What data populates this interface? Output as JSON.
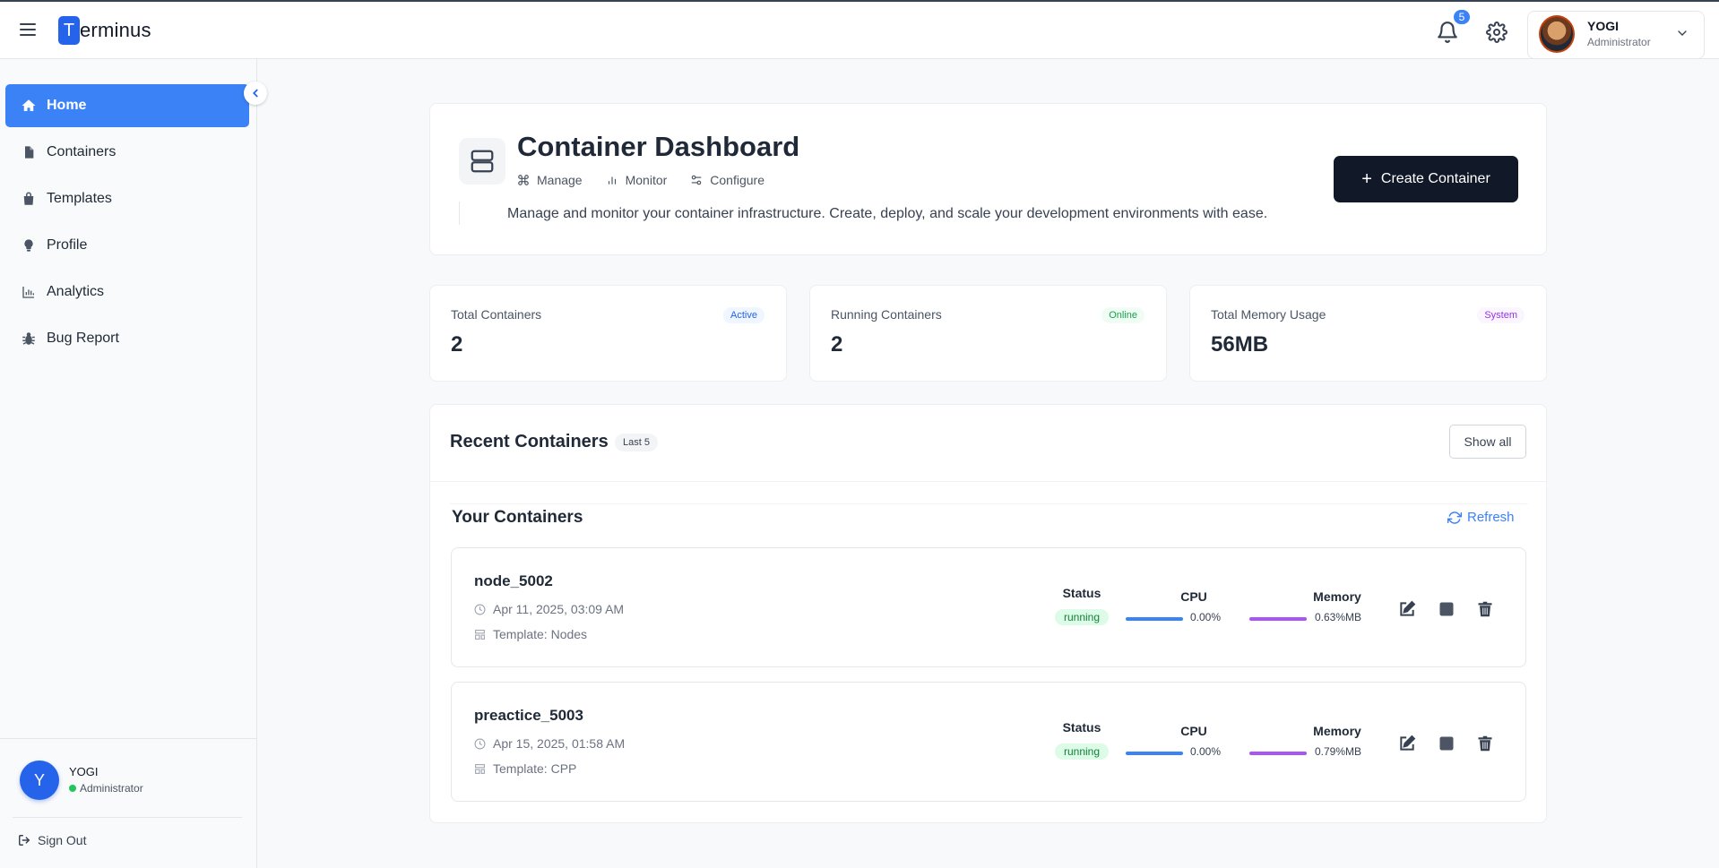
{
  "header": {
    "logo_letter": "T",
    "logo_rest": "erminus",
    "notification_count": "5",
    "user_name": "YOGI",
    "user_role": "Administrator"
  },
  "sidebar": {
    "items": [
      {
        "label": "Home",
        "icon": "home-icon",
        "active": true
      },
      {
        "label": "Containers",
        "icon": "file-icon"
      },
      {
        "label": "Templates",
        "icon": "bag-icon"
      },
      {
        "label": "Profile",
        "icon": "bulb-icon"
      },
      {
        "label": "Analytics",
        "icon": "chart-icon"
      },
      {
        "label": "Bug Report",
        "icon": "bug-icon"
      }
    ],
    "footer": {
      "avatar_initial": "Y",
      "name": "YOGI",
      "role": "Administrator",
      "sign_out": "Sign Out"
    }
  },
  "hero": {
    "title": "Container Dashboard",
    "tags": [
      "Manage",
      "Monitor",
      "Configure"
    ],
    "description": "Manage and monitor your container infrastructure. Create, deploy, and scale your development environments with ease.",
    "create_button": "Create Container"
  },
  "stats": [
    {
      "label": "Total Containers",
      "value": "2",
      "badge": "Active",
      "badge_color": "#2563eb",
      "badge_bg": "#eff6ff"
    },
    {
      "label": "Running Containers",
      "value": "2",
      "badge": "Online",
      "badge_color": "#16a34a",
      "badge_bg": "#f0fdf4"
    },
    {
      "label": "Total Memory Usage",
      "value": "56MB",
      "badge": "System",
      "badge_color": "#9333ea",
      "badge_bg": "#faf5ff"
    }
  ],
  "recent": {
    "title": "Recent Containers",
    "badge": "Last 5",
    "show_all": "Show all",
    "section_title": "Your Containers",
    "refresh": "Refresh",
    "columns": {
      "status": "Status",
      "cpu": "CPU",
      "memory": "Memory"
    },
    "containers": [
      {
        "name": "node_5002",
        "date": "Apr 11, 2025, 03:09 AM",
        "template": "Template: Nodes",
        "status": "running",
        "cpu": "0.00%",
        "memory": "0.63%MB"
      },
      {
        "name": "preactice_5003",
        "date": "Apr 15, 2025, 01:58 AM",
        "template": "Template: CPP",
        "status": "running",
        "cpu": "0.00%",
        "memory": "0.79%MB"
      }
    ]
  },
  "colors": {
    "accent": "#3b82f6",
    "dark_button": "#111827",
    "cpu_bar": "#3b82f6",
    "memory_bar": "#a855f7"
  }
}
